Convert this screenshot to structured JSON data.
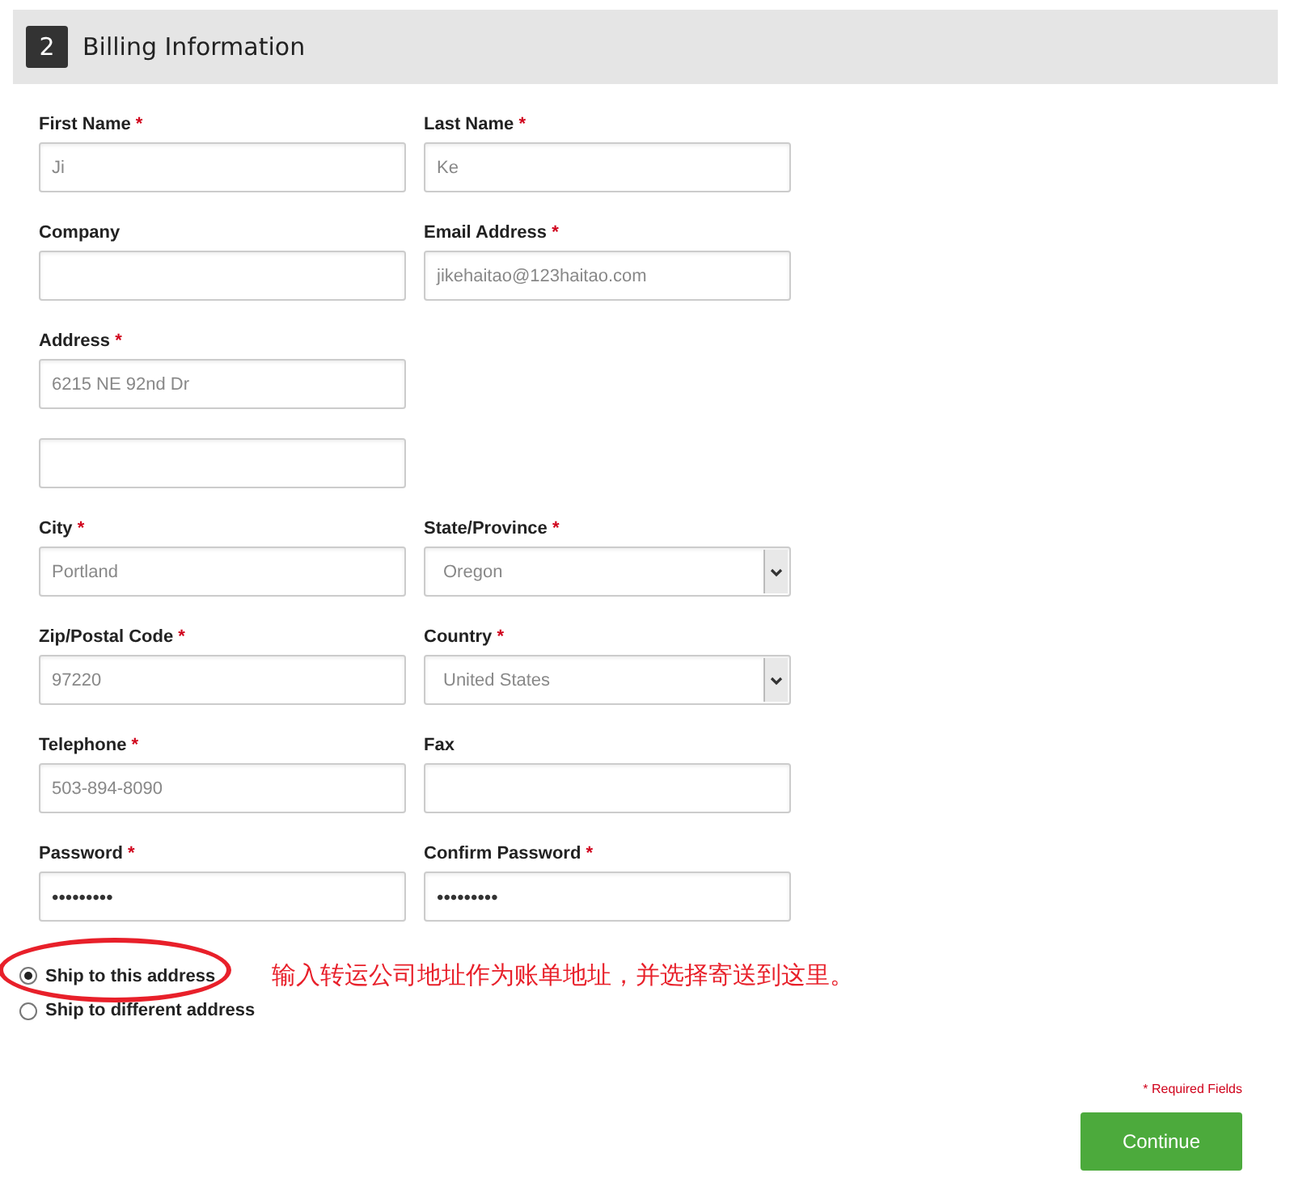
{
  "section": {
    "number": "2",
    "title": "Billing Information"
  },
  "rows": [
    [
      {
        "label": "First Name",
        "required_mark": "*",
        "kind": "text",
        "value": "Ji"
      },
      {
        "label": "Last Name",
        "required_mark": "*",
        "kind": "text",
        "value": "Ke"
      }
    ],
    [
      {
        "label": "Company",
        "kind": "text"
      },
      {
        "label": "Email Address",
        "required_mark": "*",
        "kind": "text",
        "value": "jikehaitao@123haitao.com"
      }
    ],
    [
      {
        "label": "Address",
        "required_mark": "*",
        "kind": "text",
        "value": "6215 NE 92nd Dr"
      }
    ],
    [
      {
        "kind": "text"
      }
    ],
    [
      {
        "label": "City",
        "required_mark": "*",
        "kind": "text",
        "value": "Portland"
      },
      {
        "label": "State/Province",
        "required_mark": "*",
        "kind": "select",
        "value": "Oregon"
      }
    ],
    [
      {
        "label": "Zip/Postal Code",
        "required_mark": "*",
        "kind": "text",
        "value": "97220"
      },
      {
        "label": "Country",
        "required_mark": "*",
        "kind": "select",
        "value": "United States"
      }
    ],
    [
      {
        "label": "Telephone",
        "required_mark": "*",
        "kind": "text",
        "value": "503-894-8090"
      },
      {
        "label": "Fax",
        "kind": "text"
      }
    ],
    [
      {
        "label": "Password",
        "required_mark": "*",
        "kind": "password",
        "value": "•••••••••"
      },
      {
        "label": "Confirm Password",
        "required_mark": "*",
        "kind": "password",
        "value": "•••••••••"
      }
    ]
  ],
  "shipping_options": [
    {
      "label": "Ship to this address",
      "selected": true,
      "circled": true
    },
    {
      "label": "Ship to different address",
      "selected": false,
      "circled": false
    }
  ],
  "annotation": "输入转运公司地址作为账单地址，并选择寄送到这里。",
  "required_note": "* Required Fields",
  "continue_button": "Continue"
}
